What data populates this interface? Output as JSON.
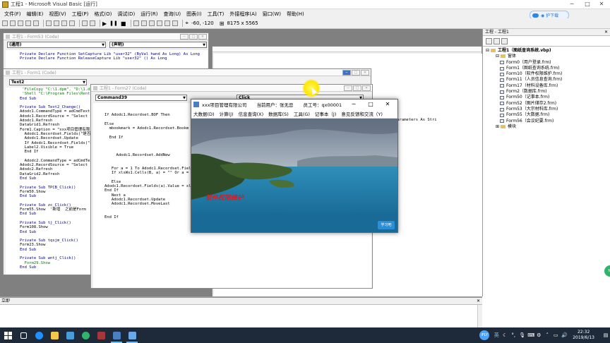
{
  "window": {
    "title": "工程1 - Microsoft Visual Basic [运行]"
  },
  "menu": [
    "文件(F)",
    "编辑(E)",
    "视图(V)",
    "工程(P)",
    "格式(O)",
    "调试(D)",
    "运行(R)",
    "查询(U)",
    "图表(I)",
    "工具(T)",
    "外接程序(A)",
    "窗口(W)",
    "帮助(H)"
  ],
  "toolbar": {
    "coords": "-60, -120",
    "size": "8175 x 5565"
  },
  "baidu": {
    "label": "◉ 护下载"
  },
  "form53": {
    "title": "工程1 - Form53 (Code)",
    "combo_left": "(通用)",
    "combo_right": "(声明)",
    "lines": [
      "Private Declare Function SetCapture Lib \"user32\" (ByVal hwnd As Long) As Long",
      "Private Declare Function ReleaseCapture Lib \"user32\" () As Long"
    ]
  },
  "form1": {
    "title": "工程1 - Form1 (Code)",
    "combo_left": "Text2",
    "lines": [
      " 'FileCopy \"C:\\1.dpm\", \"D:\\1.dpm",
      " 'Shell \"C:\\Program Files\\Rentia",
      "End Sub",
      "",
      "Private Sub Text2_Change()",
      "Adodc1.CommandType = adCmdText",
      "Adodc1.RecordSource = \"Select *",
      "Adodc1.Refresh",
      "DataGrid1.Refresh",
      "Form1.Caption = \"xxx项目管理有限",
      "  Adodc1.Recordset.Fields(\"是否",
      "  Adodc1.Recordset.Update",
      "  If Adodc1.Recordset.Fields(\"软",
      "  Label2.Visible = True",
      "  End If",
      "",
      "  Adodc2.CommandType = adCmdText",
      "Adodc2.RecordSource = \"Select *",
      "Adodc2.Refresh",
      "DataGrid2.Refresh",
      "End Sub",
      "",
      "Private Sub TPCB_Click()",
      "Form50.Show",
      "End Sub",
      "",
      "Private Sub zc_Click()",
      "Form55.Show  '新增  之前是Form",
      "End Sub",
      "",
      "Private Sub tj_Click()",
      "Form108.Show",
      "End Sub",
      "",
      "Private Sub tqsjm_Click()",
      "Form23.Show",
      "End Sub",
      "",
      "Private Sub wntj_Click()",
      "  Form29.Show",
      "End Sub"
    ]
  },
  "form27": {
    "title": "工程1 - Form27 (Code)",
    "combo_left": "Command39",
    "combo_right": "Click",
    "lines": [
      "",
      "If Adodc1.Recordset.BOF Then",
      "",
      "Else",
      "  mbookmark = Adodc1.Recordset.Bookm",
      "",
      "  End If",
      "",
      "",
      "",
      "     Adodc1.Recordset.AddNew",
      "",
      "",
      "   For a = 1 To Adodc1.Recordset.Fiel",
      "   If xlsWs1.Cells(B, a) = \"\" Or a =",
      "",
      "   Else",
      "Adodc1.Recordset.Fields(a).Value = xls",
      "End If",
      "   Next a",
      "   Adodc1.Recordset.Update",
      "   Adodc1.Recordset.MoveLast",
      "",
      "",
      "End If"
    ],
    "right_fragment": "Parameters As Stri"
  },
  "app": {
    "company": "xxx项目管理有限公司",
    "user_label": "当前用户：张无忌",
    "emp_label": "员工号：qx00001",
    "menu": [
      "大数据(D)",
      "计算(J)",
      "信息查询(X)",
      "数据库(S)",
      "工具(G)",
      "记事本（J)",
      "意见反馈和交流（Y)"
    ],
    "watermark": "软件权限维护",
    "logo": "学习吧"
  },
  "project": {
    "header": "工程 - 工程1",
    "root": "工程1（图纸查询系统.vbp)",
    "folder_forms": "窗体",
    "forms": [
      "Form0（用户登录.frm)",
      "Form1（图纸查询系统.frm)",
      "Form10（软件权限维护.frm)",
      "Form11（人员信息查询.frm)",
      "Form17（材料设备库.frm)",
      "Form2（数据库.frm)",
      "Form50（记事本.frm)",
      "Form52（图片储存2.frm)",
      "Form53（大宗材料库.frm)",
      "Form55（大数据.frm)",
      "Form56（会议纪要.frm)"
    ],
    "folder_modules": "模块"
  },
  "immediate": {
    "title": "立即"
  },
  "taskbar": {
    "time": "22:32",
    "date": "2019/6/13",
    "ime": "英"
  },
  "colors": {
    "vb_code_bg": "#ffffff",
    "workspace": "#808080",
    "taskbar": "#1e2a3a",
    "watermark": "#d0202a"
  }
}
